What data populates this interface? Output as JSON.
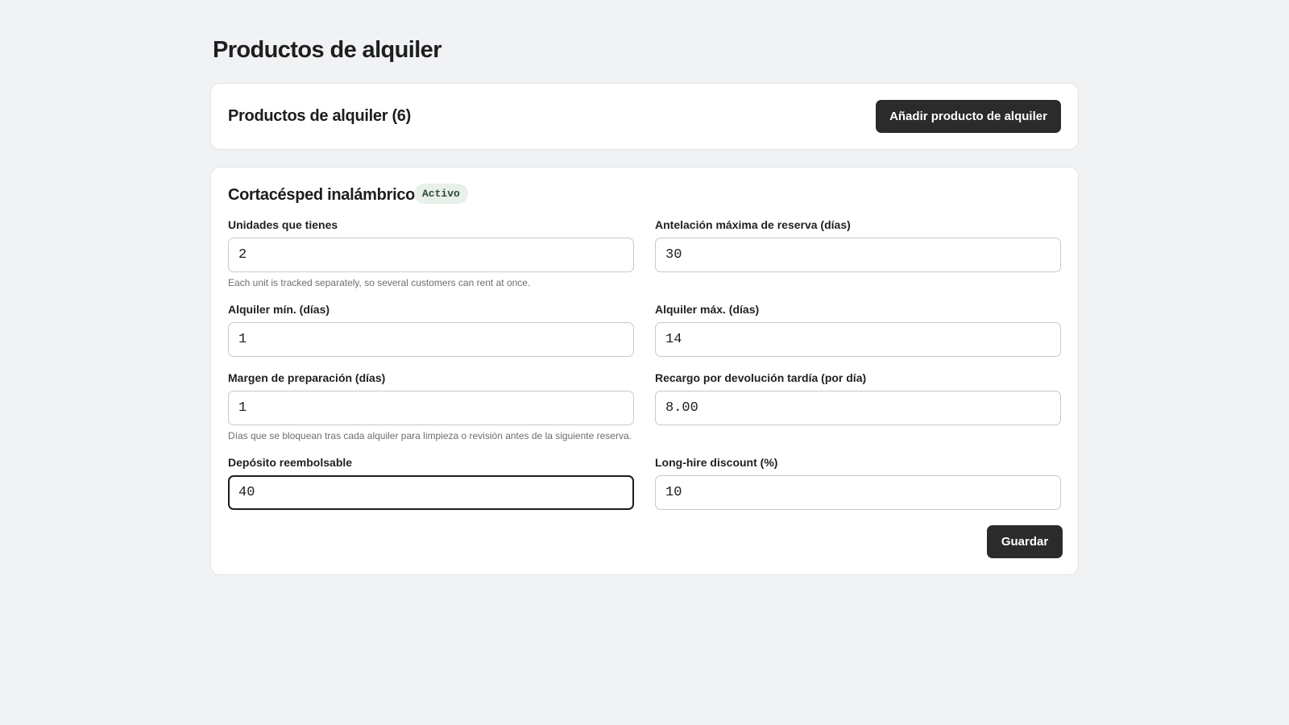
{
  "page": {
    "title": "Productos de alquiler"
  },
  "header_card": {
    "count_title": "Productos de alquiler (6)",
    "add_button_label": "Añadir producto de alquiler"
  },
  "product": {
    "name": "Cortacésped inalámbrico",
    "status_badge": "Activo",
    "fields": {
      "units": {
        "label": "Unidades que tienes",
        "value": "2",
        "help": "Each unit is tracked separately, so several customers can rent at once."
      },
      "max_advance": {
        "label": "Antelación máxima de reserva (días)",
        "value": "30"
      },
      "min_rental": {
        "label": "Alquiler mín. (días)",
        "value": "1"
      },
      "max_rental": {
        "label": "Alquiler máx. (días)",
        "value": "14"
      },
      "prep_margin": {
        "label": "Margen de preparación (días)",
        "value": "1",
        "help": "Días que se bloquean tras cada alquiler para limpieza o revisión antes de la siguiente reserva."
      },
      "late_fee": {
        "label": "Recargo por devolución tardía (por día)",
        "value": "8.00"
      },
      "deposit": {
        "label": "Depósito reembolsable",
        "value": "40"
      },
      "long_hire_discount": {
        "label": "Long-hire discount (%)",
        "value": "10"
      }
    },
    "save_button_label": "Guardar"
  },
  "colors": {
    "background": "#f1f2f3",
    "card": "#ffffff",
    "button_dark": "#2b2b2b",
    "badge_bg": "#e9efe9",
    "badge_text": "#2a4a33"
  }
}
